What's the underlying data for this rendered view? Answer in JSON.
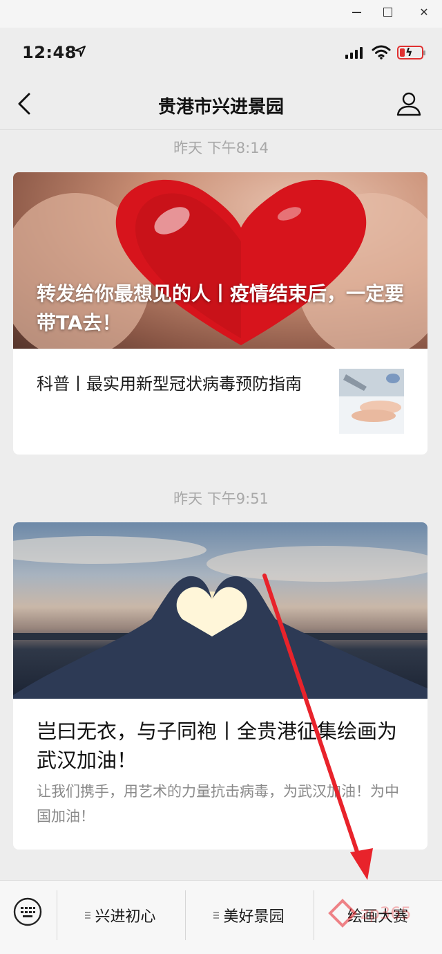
{
  "window": {
    "minimize": "—",
    "maximize": "□",
    "close": "✕"
  },
  "status_bar": {
    "time": "12:48"
  },
  "nav": {
    "title": "贵港市兴进景园"
  },
  "feed": [
    {
      "timestamp": "昨天 下午8:14",
      "hero_title": "转发给你最想见的人丨疫情结束后，一定要带TA去！",
      "sub_article": "科普丨最实用新型冠状病毒预防指南"
    },
    {
      "timestamp": "昨天 下午9:51",
      "title": "岂曰无衣，与子同袍丨全贵港征集绘画为武汉加油！",
      "desc": "让我们携手，用艺术的力量抗击病毒，为武汉加油！为中国加油！"
    }
  ],
  "menu": {
    "items": [
      "兴进初心",
      "美好景园",
      "绘画大赛"
    ]
  },
  "colors": {
    "background": "#ededed",
    "annotation_arrow": "#e8232b"
  }
}
